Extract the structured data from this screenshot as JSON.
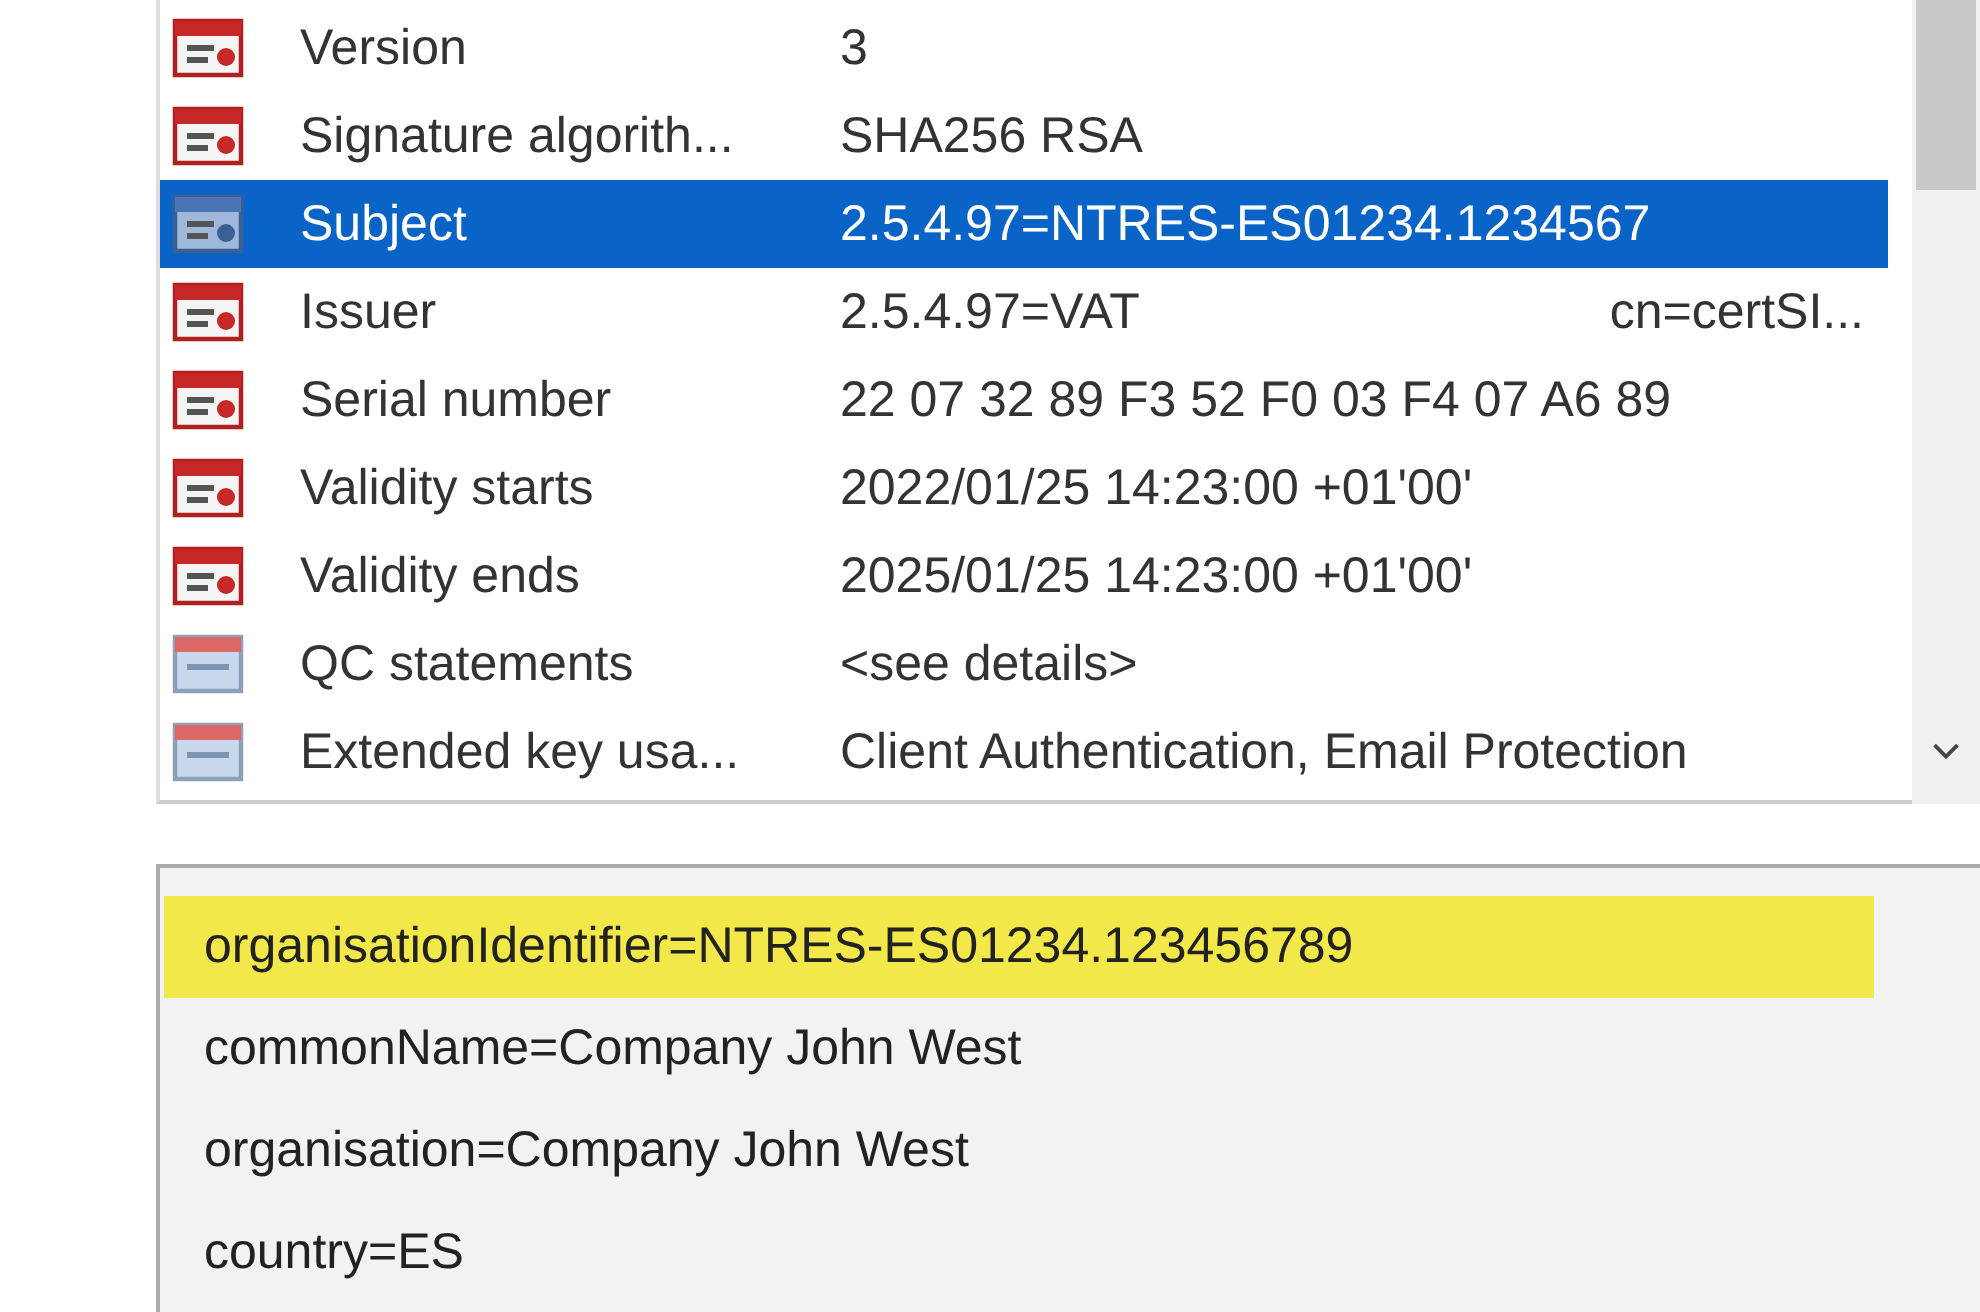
{
  "fields": [
    {
      "kind": "field",
      "name": "Version",
      "value": "3",
      "selected": false
    },
    {
      "kind": "field",
      "name": "Signature algorith...",
      "value": "SHA256 RSA",
      "selected": false
    },
    {
      "kind": "field",
      "name": "Subject",
      "value": "2.5.4.97=NTRES-ES01234.1234567",
      "selected": true
    },
    {
      "kind": "field",
      "name": "Issuer",
      "value": "2.5.4.97=VAT",
      "value_extra": "cn=certSI...",
      "selected": false
    },
    {
      "kind": "field",
      "name": "Serial number",
      "value": "22 07 32 89 F3 52 F0 03 F4 07 A6 89",
      "selected": false
    },
    {
      "kind": "field",
      "name": "Validity starts",
      "value": "2022/01/25 14:23:00 +01'00'",
      "selected": false
    },
    {
      "kind": "field",
      "name": "Validity ends",
      "value": "2025/01/25 14:23:00 +01'00'",
      "selected": false
    },
    {
      "kind": "extension",
      "name": "QC statements",
      "value": "<see details>",
      "selected": false
    },
    {
      "kind": "extension",
      "name": "Extended key usa...",
      "value": "Client Authentication, Email Protection",
      "selected": false
    }
  ],
  "details": [
    {
      "text": "organisationIdentifier=NTRES-ES01234.123456789",
      "highlighted": true
    },
    {
      "text": "commonName=Company John West",
      "highlighted": false
    },
    {
      "text": "organisation=Company John West",
      "highlighted": false
    },
    {
      "text": "country=ES",
      "highlighted": false
    }
  ]
}
